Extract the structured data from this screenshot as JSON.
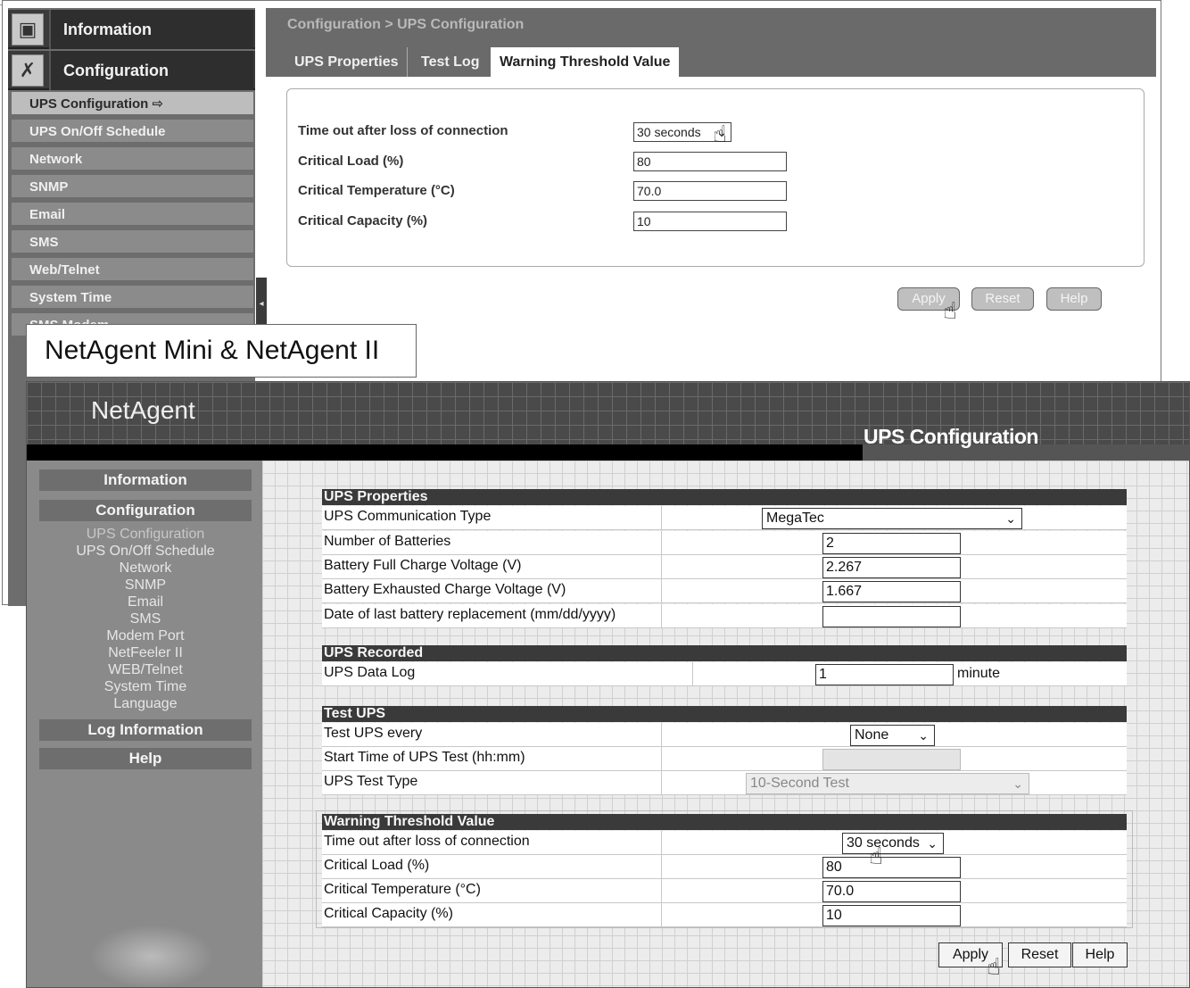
{
  "back": {
    "nav_heads": [
      {
        "label": "Information",
        "icon": "monitor-icon"
      },
      {
        "label": "Configuration",
        "icon": "tools-icon"
      }
    ],
    "nav_items": [
      {
        "label": "UPS Configuration",
        "active": true,
        "suffix": "⇨"
      },
      {
        "label": "UPS On/Off Schedule"
      },
      {
        "label": "Network"
      },
      {
        "label": "SNMP"
      },
      {
        "label": "Email"
      },
      {
        "label": "SMS"
      },
      {
        "label": "Web/Telnet"
      },
      {
        "label": "System Time"
      },
      {
        "label": "SMS Modem"
      }
    ],
    "breadcrumb": "Configuration > UPS Configuration",
    "tabs": [
      "UPS Properties",
      "Test Log",
      "Warning Threshold Value"
    ],
    "fields": {
      "timeout_label": "Time out after loss of connection",
      "timeout_value": "30 seconds",
      "load_label": "Critical Load (%)",
      "load_value": "80",
      "temp_label": "Critical Temperature (°C)",
      "temp_value": "70.0",
      "capacity_label": "Critical Capacity (%)",
      "capacity_value": "10"
    },
    "buttons": {
      "apply": "Apply",
      "reset": "Reset",
      "help": "Help"
    }
  },
  "label_box": "NetAgent Mini & NetAgent II",
  "front": {
    "logo": "NetAgent",
    "page_title": "UPS Configuration",
    "nav": {
      "information": "Information",
      "configuration": "Configuration",
      "items": [
        "UPS Configuration",
        "UPS On/Off Schedule",
        "Network",
        "SNMP",
        "Email",
        "SMS",
        "Modem Port",
        "NetFeeler II",
        "WEB/Telnet",
        "System Time",
        "Language"
      ],
      "log_information": "Log Information",
      "help": "Help"
    },
    "ups_properties": {
      "title": "UPS Properties",
      "comm_type_label": "UPS Communication Type",
      "comm_type_value": "MegaTec",
      "batteries_label": "Number of Batteries",
      "batteries_value": "2",
      "full_charge_label": "Battery Full Charge Voltage (V)",
      "full_charge_value": "2.267",
      "exhausted_label": "Battery Exhausted Charge Voltage (V)",
      "exhausted_value": "1.667",
      "replacement_label": "Date of last battery replacement (mm/dd/yyyy)",
      "replacement_value": ""
    },
    "ups_recorded": {
      "title": "UPS Recorded",
      "data_log_label": "UPS Data Log",
      "data_log_value": "1",
      "data_log_unit": "minute"
    },
    "test_ups": {
      "title": "Test UPS",
      "every_label": "Test UPS every",
      "every_value": "None",
      "start_label": "Start Time of UPS Test (hh:mm)",
      "start_value": "",
      "type_label": "UPS Test Type",
      "type_value": "10-Second Test"
    },
    "warning": {
      "title": "Warning Threshold Value",
      "timeout_label": "Time out after loss of connection",
      "timeout_value": "30 seconds",
      "load_label": "Critical Load (%)",
      "load_value": "80",
      "temp_label": "Critical Temperature (°C)",
      "temp_value": "70.0",
      "capacity_label": "Critical Capacity (%)",
      "capacity_value": "10"
    },
    "buttons": {
      "apply": "Apply",
      "reset": "Reset",
      "help": "Help"
    }
  }
}
